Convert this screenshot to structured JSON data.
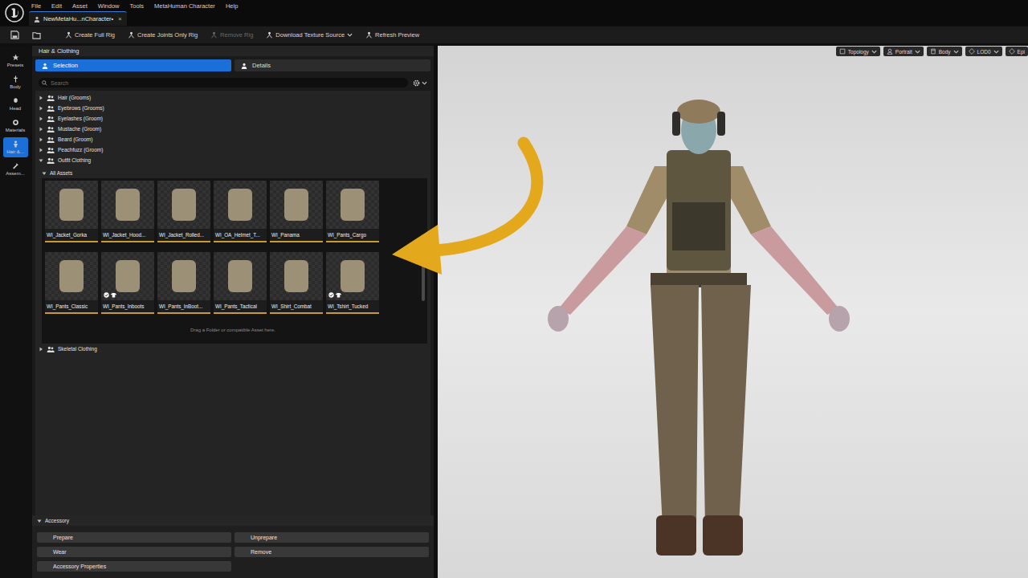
{
  "menu": [
    "File",
    "Edit",
    "Asset",
    "Window",
    "Tools",
    "MetaHuman Character",
    "Help"
  ],
  "document_tab": {
    "label": "NewMetaHu...nCharacter•",
    "close": "×",
    "selected": true
  },
  "toolbar": [
    {
      "label": "Create Full Rig",
      "disabled": false,
      "dropdown": false
    },
    {
      "label": "Create Joints Only Rig",
      "disabled": false,
      "dropdown": false
    },
    {
      "label": "Remove Rig",
      "disabled": true,
      "dropdown": false
    },
    {
      "label": "Download Texture Source",
      "disabled": false,
      "dropdown": true
    },
    {
      "label": "Refresh Preview",
      "disabled": false,
      "dropdown": false
    }
  ],
  "sidebar": [
    {
      "label": "Presets",
      "selected": false
    },
    {
      "label": "Body",
      "selected": false
    },
    {
      "label": "Head",
      "selected": false
    },
    {
      "label": "Materials",
      "selected": false
    },
    {
      "label": "Hair &...",
      "selected": true
    },
    {
      "label": "Assem...",
      "selected": false
    }
  ],
  "panel": {
    "title": "Hair & Clothing",
    "tabs": [
      {
        "label": "Selection",
        "selected": true
      },
      {
        "label": "Details",
        "selected": false
      }
    ],
    "search": {
      "placeholder": "Search"
    },
    "tree": [
      {
        "label": "Hair (Grooms)",
        "expanded": false
      },
      {
        "label": "Eyebrows (Grooms)",
        "expanded": false
      },
      {
        "label": "Eyelashes (Groom)",
        "expanded": false
      },
      {
        "label": "Mustache (Groom)",
        "expanded": false
      },
      {
        "label": "Beard (Groom)",
        "expanded": false
      },
      {
        "label": "Peachfuzz (Groom)",
        "expanded": false
      },
      {
        "label": "Outfit Clothing",
        "expanded": true
      }
    ],
    "assets": {
      "label": "All Assets",
      "expanded": true,
      "items": [
        {
          "label": "WI_Jacket_Gorka",
          "worn": false
        },
        {
          "label": "WI_Jacket_Hood...",
          "worn": false
        },
        {
          "label": "WI_Jacket_Rolled...",
          "worn": false
        },
        {
          "label": "WI_OA_Helmet_T...",
          "worn": false
        },
        {
          "label": "WI_Panama",
          "worn": false
        },
        {
          "label": "WI_Pants_Cargo",
          "worn": false
        },
        {
          "label": "WI_Pants_Classic",
          "worn": false
        },
        {
          "label": "WI_Pants_Inboots",
          "worn": true
        },
        {
          "label": "WI_Pants_InBoot...",
          "worn": false
        },
        {
          "label": "WI_Pants_Tactical",
          "worn": false
        },
        {
          "label": "WI_Shirt_Combat",
          "worn": false
        },
        {
          "label": "WI_Tshirt_Tucked",
          "worn": true
        }
      ],
      "drop_hint": "Drag a Folder or compatible Asset here."
    },
    "tree_after": [
      {
        "label": "Skeletal Clothing",
        "expanded": false
      }
    ]
  },
  "accessory": {
    "title": "Accessory",
    "expanded": true,
    "buttons": [
      "Prepare",
      "Unprepare",
      "Wear",
      "Remove",
      "Accessory Properties"
    ]
  },
  "viewport": {
    "toolbar": [
      {
        "label": "Topology",
        "dropdown": true
      },
      {
        "label": "Portrait",
        "dropdown": true
      },
      {
        "label": "Body",
        "dropdown": true
      },
      {
        "label": "LOD0",
        "dropdown": true
      },
      {
        "label": "Epi",
        "dropdown": false
      }
    ]
  }
}
